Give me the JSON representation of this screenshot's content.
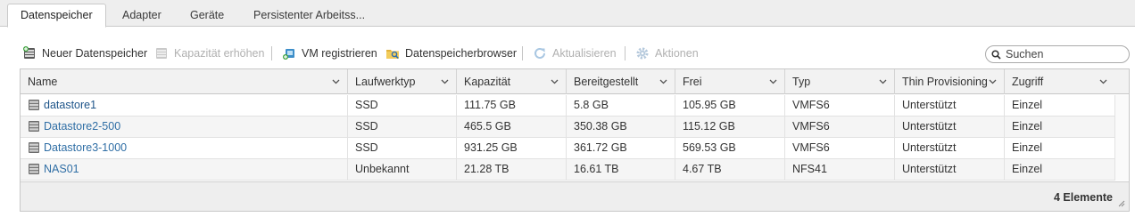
{
  "tabs": [
    {
      "label": "Datenspeicher",
      "active": true
    },
    {
      "label": "Adapter",
      "active": false
    },
    {
      "label": "Geräte",
      "active": false
    },
    {
      "label": "Persistenter Arbeitss...",
      "active": false
    }
  ],
  "toolbar": {
    "new_datastore": {
      "label": "Neuer Datenspeicher",
      "icon": "new-datastore-icon",
      "enabled": true
    },
    "increase_capacity": {
      "label": "Kapazität erhöhen",
      "icon": "increase-capacity-icon",
      "enabled": false
    },
    "register_vm": {
      "label": "VM registrieren",
      "icon": "register-vm-icon",
      "enabled": true
    },
    "datastore_browser": {
      "label": "Datenspeicherbrowser",
      "icon": "datastore-browser-icon",
      "enabled": true
    },
    "refresh": {
      "label": "Aktualisieren",
      "icon": "refresh-icon",
      "enabled": false
    },
    "actions": {
      "label": "Aktionen",
      "icon": "gear-icon",
      "enabled": false
    }
  },
  "search": {
    "placeholder": "Suchen",
    "value": ""
  },
  "table": {
    "columns": [
      "Name",
      "Laufwerktyp",
      "Kapazität",
      "Bereitgestellt",
      "Frei",
      "Typ",
      "Thin Provisioning",
      "Zugriff"
    ],
    "rows": [
      {
        "name": "datastore1",
        "drive_type": "SSD",
        "capacity": "111.75 GB",
        "provisioned": "5.8 GB",
        "free": "105.95 GB",
        "type": "VMFS6",
        "thin_provisioning": "Unterstützt",
        "access": "Einzel"
      },
      {
        "name": "Datastore2-500",
        "drive_type": "SSD",
        "capacity": "465.5 GB",
        "provisioned": "350.38 GB",
        "free": "115.12 GB",
        "type": "VMFS6",
        "thin_provisioning": "Unterstützt",
        "access": "Einzel"
      },
      {
        "name": "Datastore3-1000",
        "drive_type": "SSD",
        "capacity": "931.25 GB",
        "provisioned": "361.72 GB",
        "free": "569.53 GB",
        "type": "VMFS6",
        "thin_provisioning": "Unterstützt",
        "access": "Einzel"
      },
      {
        "name": "NAS01",
        "drive_type": "Unbekannt",
        "capacity": "21.28 TB",
        "provisioned": "16.61 TB",
        "free": "4.67 TB",
        "type": "NFS41",
        "thin_provisioning": "Unterstützt",
        "access": "Einzel"
      }
    ],
    "footer_count": "4 Elemente"
  },
  "colors": {
    "link": "#2f6ea5",
    "disabled_text": "#b0b0b0",
    "header_bg": "#f2f2f2",
    "tabbar_bg": "#eeeeee"
  }
}
